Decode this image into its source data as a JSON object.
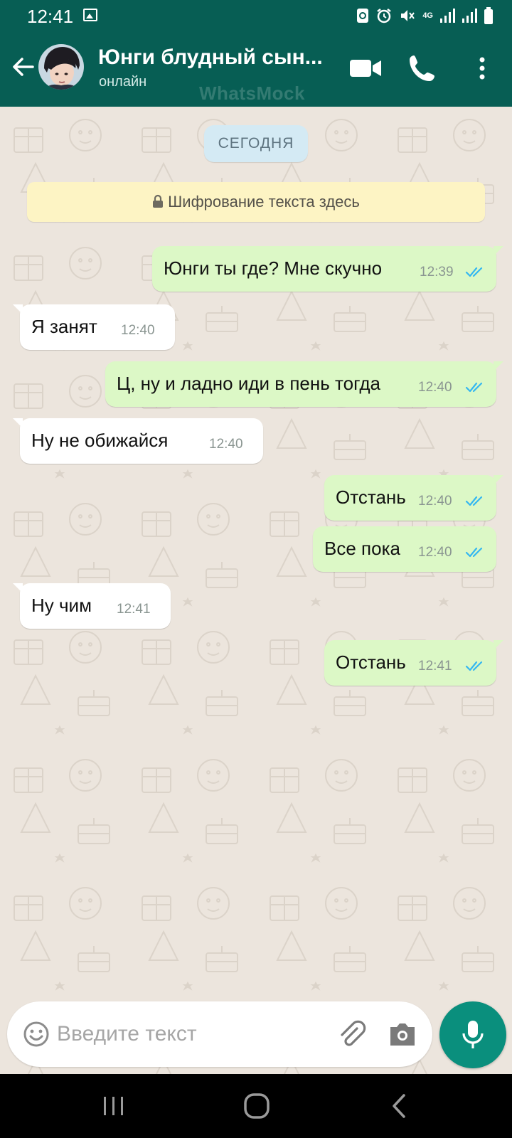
{
  "status_bar": {
    "time": "12:41",
    "network": "4G",
    "icons": [
      "gallery-icon",
      "sync-icon",
      "alarm-icon",
      "mute-icon",
      "signal-icon",
      "signal-icon",
      "battery-icon"
    ]
  },
  "header": {
    "contact_name": "Юнги блудный сын...",
    "contact_status": "онлайн",
    "watermark": "WhatsMock",
    "icons": [
      "back-arrow-icon",
      "avatar",
      "video-call-icon",
      "phone-icon",
      "more-vert-icon"
    ]
  },
  "chat": {
    "date_chip": "СЕГОДНЯ",
    "encryption_note": "Шифрование текста здесь",
    "messages": [
      {
        "direction": "out",
        "text": "Юнги ты где? Мне скучно",
        "time": "12:39",
        "status": "read"
      },
      {
        "direction": "in",
        "text": "Я занят",
        "time": "12:40"
      },
      {
        "direction": "out",
        "text": "Ц, ну и ладно иди в пень тогда",
        "time": "12:40",
        "status": "read"
      },
      {
        "direction": "in",
        "text": "Ну не обижайся",
        "time": "12:40"
      },
      {
        "direction": "out",
        "text": "Отстань",
        "time": "12:40",
        "status": "read"
      },
      {
        "direction": "out",
        "text": "Все пока",
        "time": "12:40",
        "status": "read"
      },
      {
        "direction": "in",
        "text": "Ну чим",
        "time": "12:41"
      },
      {
        "direction": "out",
        "text": "Отстань",
        "time": "12:41",
        "status": "read"
      }
    ]
  },
  "composer": {
    "placeholder": "Введите текст",
    "icons": [
      "emoji-icon",
      "attach-icon",
      "camera-icon",
      "mic-icon"
    ]
  },
  "colors": {
    "header": "#075e54",
    "chat_background": "#ece5dd",
    "outgoing_bubble": "#dcf8c6",
    "incoming_bubble": "#ffffff",
    "read_tick": "#34b7f1",
    "mic_button": "#0a8f7d"
  },
  "nav_bar": {
    "icons": [
      "recent-apps-icon",
      "home-icon",
      "nav-back-icon"
    ]
  }
}
